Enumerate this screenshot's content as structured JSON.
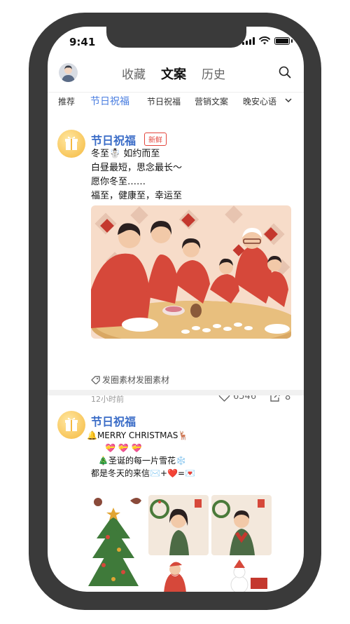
{
  "status": {
    "time": "9:41"
  },
  "header": {
    "tabs": [
      {
        "label": "收藏"
      },
      {
        "label": "文案"
      },
      {
        "label": "历史"
      }
    ]
  },
  "categories": [
    "推荐",
    "节日祝福",
    "节日祝福",
    "营销文案",
    "晚安心语"
  ],
  "post1": {
    "title": "节日祝福",
    "badge": "新鲜",
    "lines": [
      "冬至☃️ 如约而至",
      "白昼最短，思念最长～",
      "愿你冬至……",
      "福至，健康至，幸运至"
    ],
    "tag": "发圈素材发圈素材",
    "time": "12小时前",
    "likes": "6546",
    "shares": "8"
  },
  "post2": {
    "title": "节日祝福",
    "lines": [
      "🔔MERRY CHRISTMAS🦌",
      "💝 💝 💝",
      "🎄圣诞的每一片雪花❄️",
      "都是冬天的来信✉️+❤️=💌"
    ]
  },
  "colors": {
    "accent": "#4a7ee0",
    "title_blue": "#3a6cc7",
    "badge_red": "#e3453c"
  }
}
